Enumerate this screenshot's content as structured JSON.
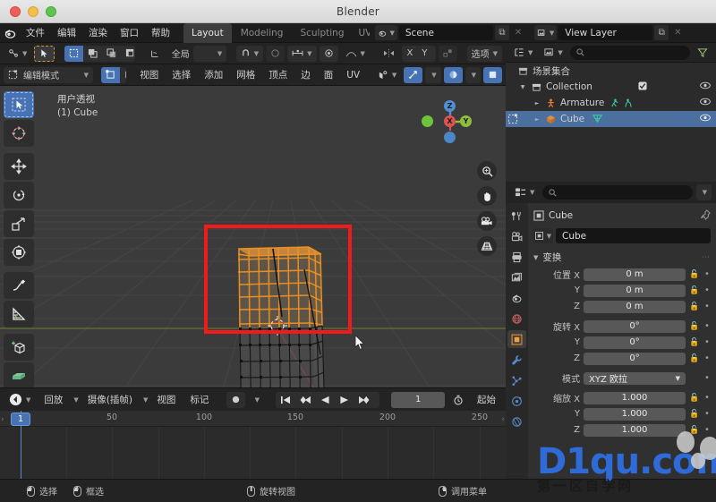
{
  "window": {
    "title": "Blender"
  },
  "topbar": {
    "menus": [
      "文件",
      "编辑",
      "渲染",
      "窗口",
      "帮助"
    ],
    "workspace_tabs": [
      {
        "label": "Layout",
        "active": true
      },
      {
        "label": "Modeling",
        "active": false
      },
      {
        "label": "Sculpting",
        "active": false
      },
      {
        "label": "UV",
        "active": false
      }
    ],
    "scene_field": "Scene",
    "viewlayer_field": "View Layer",
    "scene_icon": "scene-icon",
    "viewlayer_icon": "view-layer-icon",
    "copy_icon": "duplicate-icon",
    "close_icon": "x-icon"
  },
  "toolheader_row1": {
    "editor_type_icon": "editor-type-icon",
    "select_tool_icon": "cursor-select-icon",
    "select_modes": [
      "new-select-icon",
      "extend-select-icon",
      "subtract-select-icon",
      "invert-select-icon",
      "intersect-select-icon"
    ],
    "transform_orientation": "全局",
    "snap_icon": "snap-magnet-icon",
    "proportional_icon": "proportional-edit-icon",
    "mirror_icon": "mirror-icon",
    "mirror_axes": [
      "X",
      "Y",
      "Z"
    ],
    "options_label": "选项"
  },
  "toolheader_row2": {
    "mode": "编辑模式",
    "mesh_select_modes": [
      "vertex-select-icon",
      "edge-select-icon",
      "face-select-icon"
    ],
    "menus": [
      "视图",
      "选择",
      "添加",
      "网格",
      "顶点",
      "边",
      "面",
      "UV"
    ],
    "show_gizmo_icon": "gizmo-icon",
    "overlays_icon": "overlays-icon",
    "xray_icon": "xray-icon",
    "shading_icon": "shading-icon"
  },
  "viewport": {
    "view_label": "用户透视",
    "object_label": "(1) Cube",
    "left_tools": [
      "tweak-select-tool-icon",
      "cursor-tool-icon",
      "move-tool-icon",
      "rotate-tool-icon",
      "scale-tool-icon",
      "transform-tool-icon",
      "annotate-tool-icon",
      "measure-tool-icon",
      "add-cube-tool-icon",
      "extrude-region-tool-icon"
    ],
    "gizmo_axes": [
      {
        "label": "Z",
        "color": "#4f8fd6"
      },
      {
        "label": "Y",
        "color": "#8fbf3e"
      },
      {
        "label": "X",
        "color": "#e0524e"
      }
    ],
    "nav_buttons": [
      "zoom-icon",
      "pan-hand-icon",
      "camera-icon",
      "grid-perspective-icon"
    ],
    "annotation_rect_color": "#f11b1b"
  },
  "outliner": {
    "display_mode_icon": "outliner-display-icon",
    "filter_icon": "filter-funnel-icon",
    "search_icon": "search-icon",
    "search_placeholder": "",
    "rows": [
      {
        "label": "场景集合",
        "icon": "collection-icon",
        "depth": 0,
        "expandable": false,
        "selected": false,
        "checkbox": false,
        "eye": false
      },
      {
        "label": "Collection",
        "icon": "collection-icon",
        "depth": 1,
        "expandable": true,
        "selected": false,
        "checkbox": true,
        "eye": true
      },
      {
        "label": "Armature",
        "icon": "armature-icon",
        "depth": 2,
        "expandable": true,
        "selected": false,
        "checkbox": false,
        "eye": true
      },
      {
        "label": "Cube",
        "icon": "mesh-cube-icon",
        "depth": 2,
        "expandable": true,
        "selected": true,
        "checkbox": false,
        "eye": true
      }
    ]
  },
  "properties": {
    "editor_icon": "properties-editor-icon",
    "search_icon": "search-icon",
    "search_placeholder": "",
    "tabs": [
      {
        "name": "tool-tab",
        "glyph": "⚙",
        "active": false
      },
      {
        "name": "render-tab",
        "glyph": "▣",
        "active": false
      },
      {
        "name": "output-tab",
        "glyph": "⎙",
        "active": false
      },
      {
        "name": "view-layer-tab",
        "glyph": "⧉",
        "active": false
      },
      {
        "name": "scene-tab",
        "glyph": "◎",
        "active": false
      },
      {
        "name": "world-tab",
        "glyph": "☄",
        "active": false
      },
      {
        "name": "object-tab",
        "glyph": "■",
        "active": true
      },
      {
        "name": "modifier-tab",
        "glyph": "ὒ7",
        "active": false
      },
      {
        "name": "particles-tab",
        "glyph": "⁂",
        "active": false
      },
      {
        "name": "physics-tab",
        "glyph": "⦿",
        "active": false
      },
      {
        "name": "constraints-tab",
        "glyph": "⧈",
        "active": false
      }
    ],
    "breadcrumb": "Cube",
    "object_name": "Cube",
    "panel_title": "变换",
    "fields": [
      {
        "label": "位置 X",
        "value": "0 m"
      },
      {
        "label": "Y",
        "value": "0 m"
      },
      {
        "label": "Z",
        "value": "0 m"
      },
      {
        "label": "旋转 X",
        "value": "0°"
      },
      {
        "label": "Y",
        "value": "0°"
      },
      {
        "label": "Z",
        "value": "0°"
      },
      {
        "label": "模式",
        "value": "XYZ 欧拉",
        "dropdown": true
      },
      {
        "label": "缩放 X",
        "value": "1.000"
      },
      {
        "label": "Y",
        "value": "1.000"
      },
      {
        "label": "Z",
        "value": "1.000"
      }
    ]
  },
  "timeline": {
    "editor_icon": "timeline-editor-icon",
    "menus": [
      "回放",
      "摄像(插帧)",
      "视图",
      "标记"
    ],
    "record_icon": "record-keying-icon",
    "transport": [
      "jump-to-start-icon",
      "prev-keyframe-icon",
      "play-reverse-icon",
      "play-icon",
      "next-keyframe-icon",
      "jump-to-end-icon"
    ],
    "current_frame": "1",
    "timer_icon": "stopwatch-icon",
    "start_label": "起始",
    "ticks": [
      "50",
      "100",
      "150",
      "200",
      "250"
    ],
    "tick_positions": [
      125,
      228,
      330,
      433,
      536
    ],
    "playhead_frame": "1"
  },
  "statusbar": {
    "items": [
      {
        "label": "选择",
        "icon": "mouse-left-icon"
      },
      {
        "label": "框选",
        "icon": "mouse-left-drag-icon"
      },
      {
        "label": "旋转视图",
        "icon": "mouse-middle-icon"
      },
      {
        "label": "调用菜单",
        "icon": "mouse-right-icon"
      }
    ]
  },
  "watermark": {
    "main": "D1qu.com",
    "sub": "第一区自学网",
    "color": "#2f6bd8"
  }
}
